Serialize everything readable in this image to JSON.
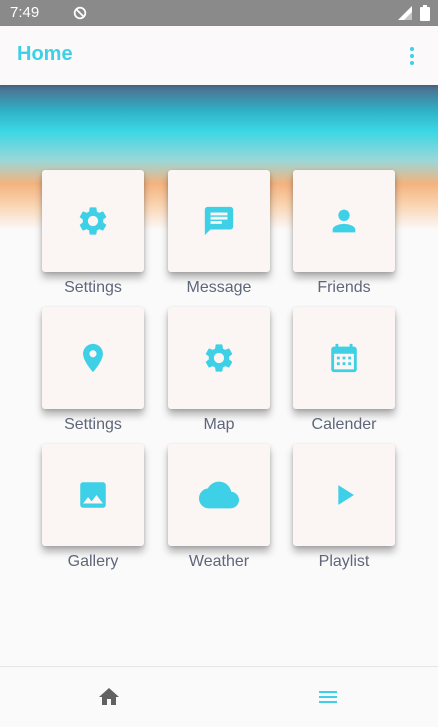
{
  "status_bar": {
    "time": "7:49"
  },
  "app_bar": {
    "title": "Home"
  },
  "colors": {
    "accent": "#3dd0e6",
    "label": "#5f6679",
    "tile": "#fbf5f3"
  },
  "tiles": [
    {
      "label": "Settings",
      "icon": "gear-icon"
    },
    {
      "label": "Message",
      "icon": "message-icon"
    },
    {
      "label": "Friends",
      "icon": "person-icon"
    },
    {
      "label": "Settings",
      "icon": "location-pin-icon"
    },
    {
      "label": "Map",
      "icon": "gear-icon"
    },
    {
      "label": "Calender",
      "icon": "calendar-icon"
    },
    {
      "label": "Gallery",
      "icon": "image-icon"
    },
    {
      "label": "Weather",
      "icon": "cloud-icon"
    },
    {
      "label": "Playlist",
      "icon": "play-icon"
    }
  ],
  "bottom_nav": {
    "items": [
      {
        "icon": "home-icon"
      },
      {
        "icon": "menu-icon"
      }
    ]
  }
}
